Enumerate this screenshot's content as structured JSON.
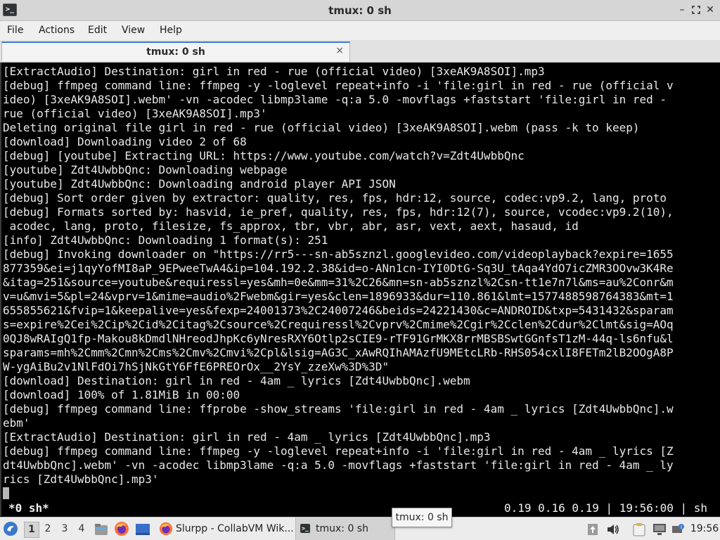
{
  "window": {
    "title": "tmux: 0 sh",
    "app_icon": ">_"
  },
  "menu": [
    "File",
    "Actions",
    "Edit",
    "View",
    "Help"
  ],
  "tab": {
    "label": "tmux: 0 sh",
    "close": "×"
  },
  "terminal": {
    "lines": [
      "[ExtractAudio] Destination: girl in red - rue (official video) [3xeAK9A8SOI].mp3",
      "[debug] ffmpeg command line: ffmpeg -y -loglevel repeat+info -i 'file:girl in red - rue (official v",
      "ideo) [3xeAK9A8SOI].webm' -vn -acodec libmp3lame -q:a 5.0 -movflags +faststart 'file:girl in red -",
      "rue (official video) [3xeAK9A8SOI].mp3'",
      "Deleting original file girl in red - rue (official video) [3xeAK9A8SOI].webm (pass -k to keep)",
      "[download] Downloading video 2 of 68",
      "[debug] [youtube] Extracting URL: https://www.youtube.com/watch?v=Zdt4UwbbQnc",
      "[youtube] Zdt4UwbbQnc: Downloading webpage",
      "[youtube] Zdt4UwbbQnc: Downloading android player API JSON",
      "[debug] Sort order given by extractor: quality, res, fps, hdr:12, source, codec:vp9.2, lang, proto",
      "[debug] Formats sorted by: hasvid, ie_pref, quality, res, fps, hdr:12(7), source, vcodec:vp9.2(10),",
      " acodec, lang, proto, filesize, fs_approx, tbr, vbr, abr, asr, vext, aext, hasaud, id",
      "[info] Zdt4UwbbQnc: Downloading 1 format(s): 251",
      "[debug] Invoking downloader on \"https://rr5---sn-ab5sznzl.googlevideo.com/videoplayback?expire=1655",
      "877359&ei=j1qyYofMI8aP_9EPweeTwA4&ip=104.192.2.38&id=o-ANn1cn-IYI0DtG-Sq3U_tAqa4YdO7icZMR3OOvw3K4Re",
      "&itag=251&source=youtube&requiressl=yes&mh=0e&mm=31%2C26&mn=sn-ab5sznzl%2Csn-tt1e7n7l&ms=au%2Conr&m",
      "v=u&mvi=5&pl=24&vprv=1&mime=audio%2Fwebm&gir=yes&clen=1896933&dur=110.861&lmt=1577488598764383&mt=1",
      "655855621&fvip=1&keepalive=yes&fexp=24001373%2C24007246&beids=24221430&c=ANDROID&txp=5431432&sparam",
      "s=expire%2Cei%2Cip%2Cid%2Citag%2Csource%2Crequiressl%2Cvprv%2Cmime%2Cgir%2Cclen%2Cdur%2Clmt&sig=AOq",
      "0QJ8wRAIgQ1fp-Makou8kDmdlNHreodJhpKc6yNresRXY6Otlp2sCIE9-rTF91GrMKX8rrMBSBSwtGGnfsT1zM-44q-ls6nfu&l",
      "sparams=mh%2Cmm%2Cmn%2Cms%2Cmv%2Cmvi%2Cpl&lsig=AG3C_xAwRQIhAMAzfU9MEtcLRb-RHS054cxlI8FETm2lB2OOgA8P",
      "W-ygAiBu2v1NlFdOi7hSjNkGtY6FfE6PREOrOx__2YsY_zzeXw%3D%3D\"",
      "[download] Destination: girl in red - 4am _ lyrics [Zdt4UwbbQnc].webm",
      "[download] 100% of 1.81MiB in 00:00",
      "[debug] ffmpeg command line: ffprobe -show_streams 'file:girl in red - 4am _ lyrics [Zdt4UwbbQnc].w",
      "ebm'",
      "[ExtractAudio] Destination: girl in red - 4am _ lyrics [Zdt4UwbbQnc].mp3",
      "[debug] ffmpeg command line: ffmpeg -y -loglevel repeat+info -i 'file:girl in red - 4am _ lyrics [Z",
      "dt4UwbbQnc].webm' -vn -acodec libmp3lame -q:a 5.0 -movflags +faststart 'file:girl in red - 4am _ ly",
      "rics [Zdt4UwbbQnc].mp3'"
    ],
    "status_left": "*0 sh*",
    "status_right": "0.19 0.16 0.19 | 19:56:00 | sh"
  },
  "tooltip": "tmux: 0 sh",
  "taskbar": {
    "workspaces": [
      "1",
      "2",
      "3",
      "4"
    ],
    "active_workspace": "1",
    "window_buttons": [
      {
        "label": "Slurpp - CollabVM Wik...",
        "icon": "firefox-icon"
      },
      {
        "label": "tmux: 0 sh",
        "icon": "terminal-icon"
      }
    ],
    "clock": "19:56"
  }
}
